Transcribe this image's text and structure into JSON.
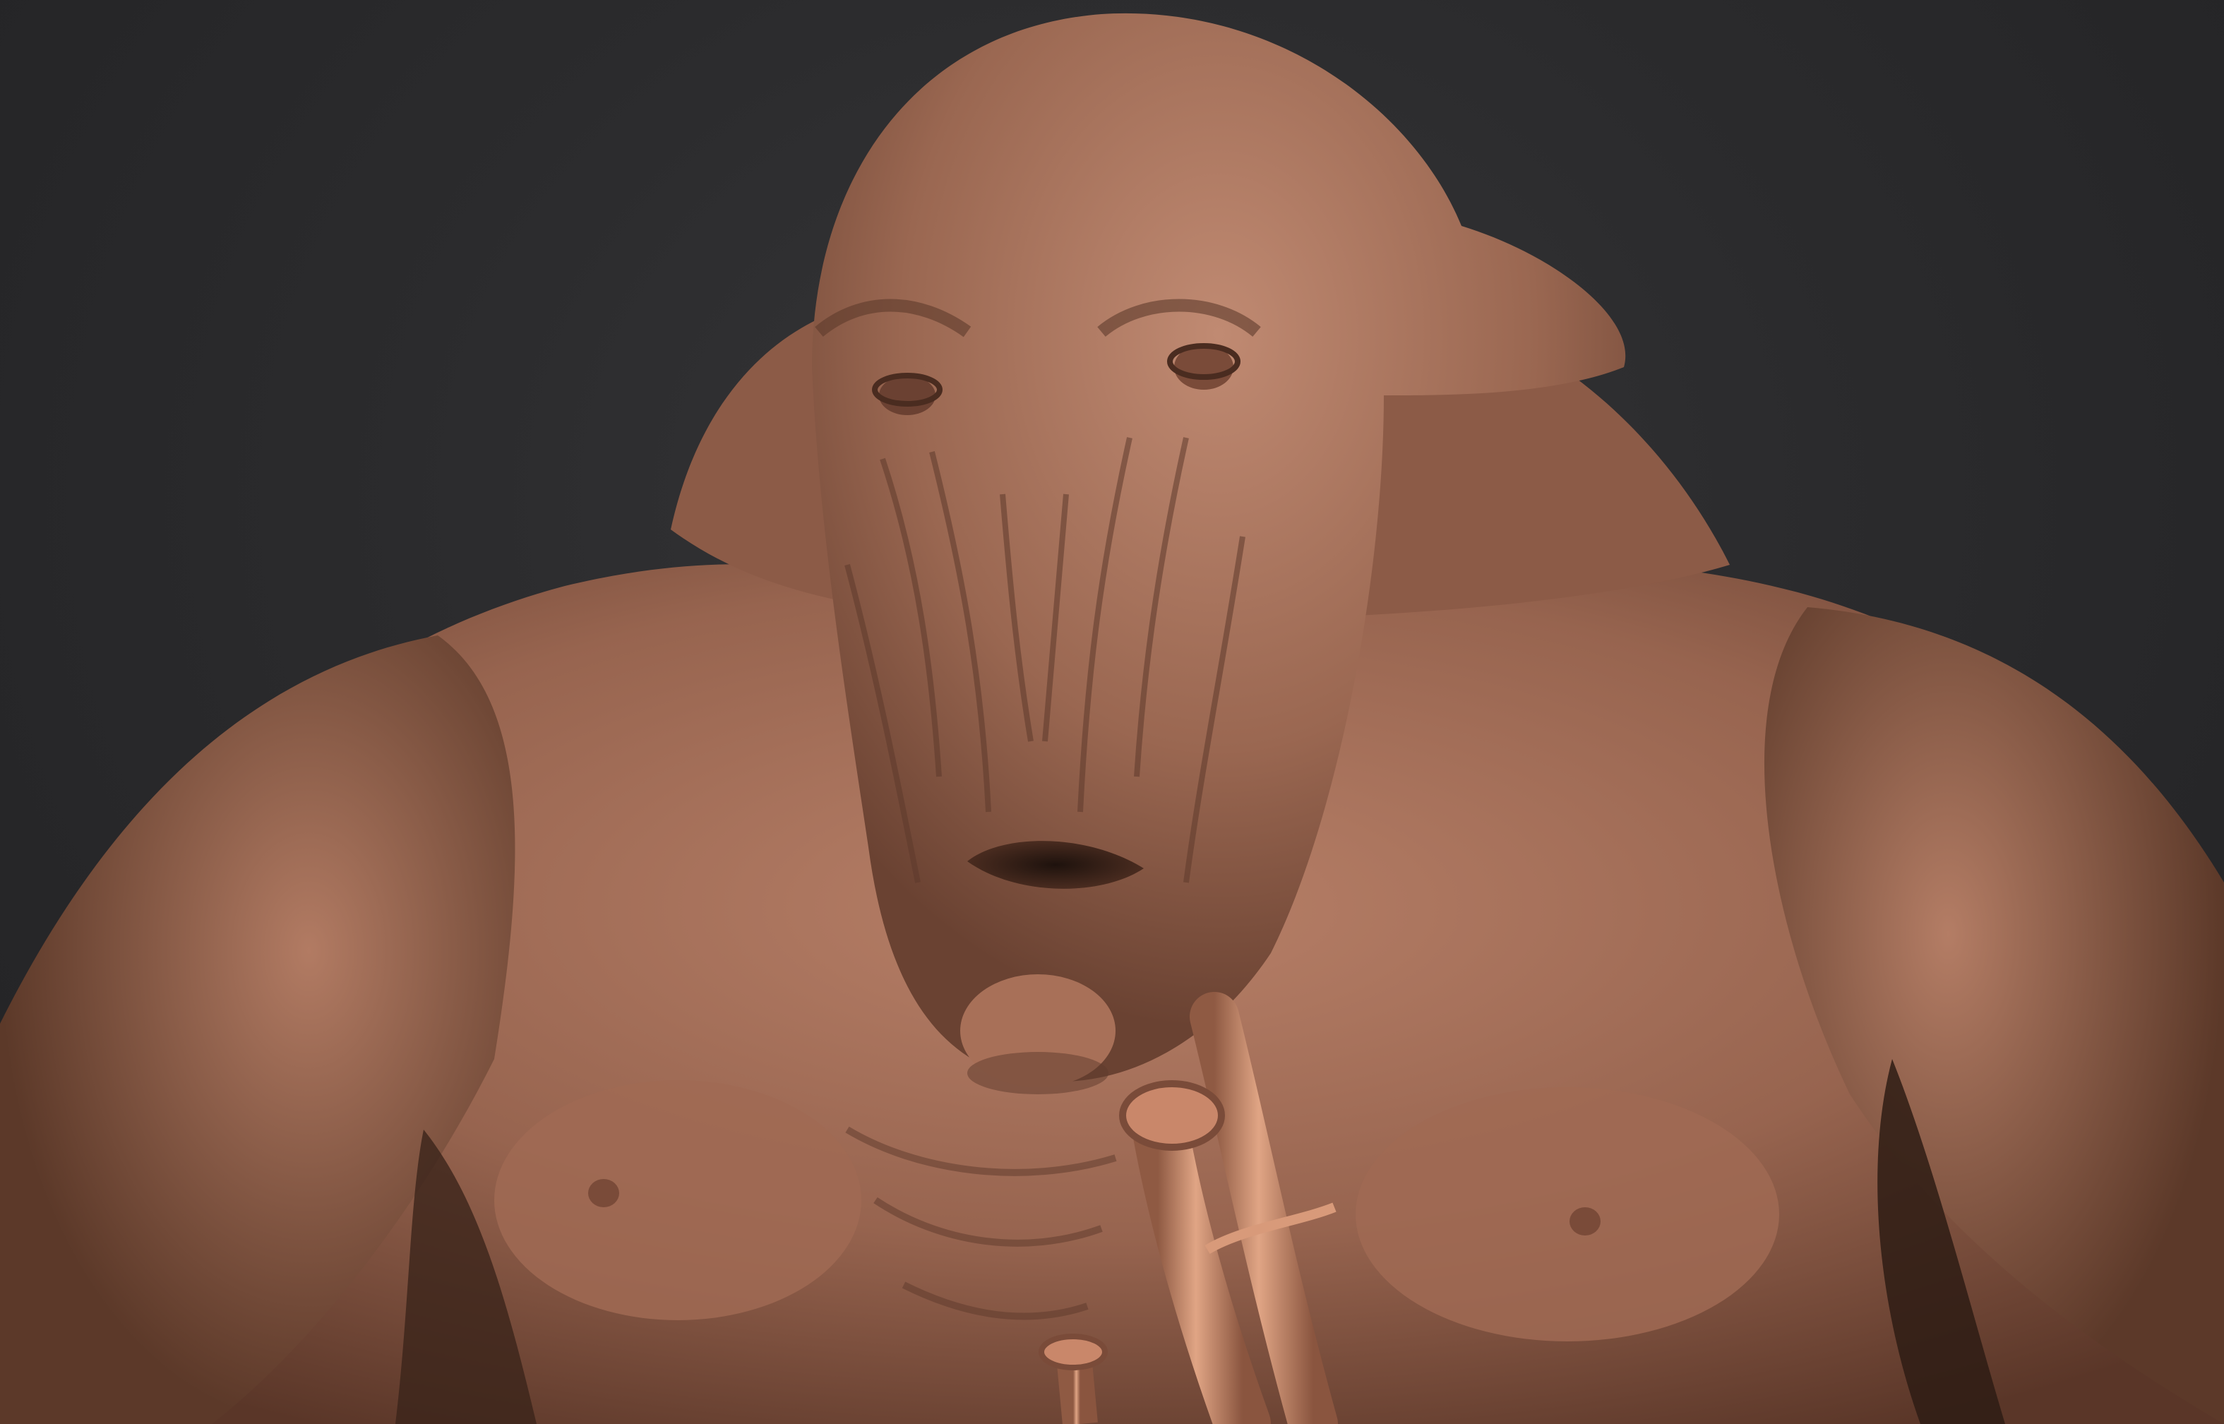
{
  "scene": {
    "background_color": "#2b2b2d",
    "clay_base_color": "#9c6a55",
    "clay_light_color": "#c08a72",
    "clay_shadow_color": "#5e3a2c",
    "tube_color": "#c98a6a",
    "subject": "clay-creature-bust"
  }
}
